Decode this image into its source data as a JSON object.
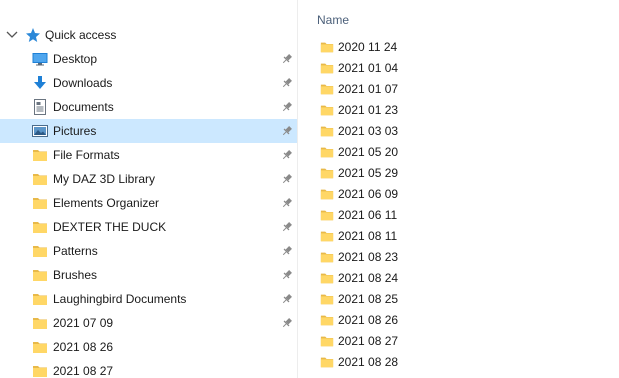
{
  "nav": {
    "quick_access": "Quick access",
    "items": [
      {
        "label": "Desktop",
        "icon": "desktop-icon",
        "pinned": true
      },
      {
        "label": "Downloads",
        "icon": "download-arrow-icon",
        "pinned": true
      },
      {
        "label": "Documents",
        "icon": "document-icon",
        "pinned": true
      },
      {
        "label": "Pictures",
        "icon": "pictures-icon",
        "pinned": true,
        "selected": true
      },
      {
        "label": "File Formats",
        "icon": "folder-icon",
        "pinned": true
      },
      {
        "label": "My DAZ 3D Library",
        "icon": "folder-icon",
        "pinned": true
      },
      {
        "label": "Elements Organizer",
        "icon": "folder-icon",
        "pinned": true
      },
      {
        "label": "DEXTER THE DUCK",
        "icon": "folder-icon",
        "pinned": true
      },
      {
        "label": "Patterns",
        "icon": "folder-icon",
        "pinned": true
      },
      {
        "label": "Brushes",
        "icon": "folder-icon",
        "pinned": true
      },
      {
        "label": "Laughingbird Documents",
        "icon": "folder-icon",
        "pinned": true
      },
      {
        "label": "2021 07 09",
        "icon": "folder-icon",
        "pinned": true
      },
      {
        "label": "2021 08 26",
        "icon": "folder-icon",
        "pinned": false
      },
      {
        "label": "2021 08 27",
        "icon": "folder-icon",
        "pinned": false
      }
    ]
  },
  "content": {
    "column_header": "Name",
    "folders": [
      "2020 11 24",
      "2021 01 04",
      "2021 01 07",
      "2021 01 23",
      "2021 03 03",
      "2021 05 20",
      "2021 05 29",
      "2021 06 09",
      "2021 06 11",
      "2021 08 11",
      "2021 08 23",
      "2021 08 24",
      "2021 08 25",
      "2021 08 26",
      "2021 08 27",
      "2021 08 28",
      ""
    ]
  },
  "colors": {
    "selection": "#cce8ff",
    "folder": "#ffd766",
    "folder_dark": "#e8b949",
    "header_text": "#4c607a",
    "accent": "#1e80d6"
  }
}
